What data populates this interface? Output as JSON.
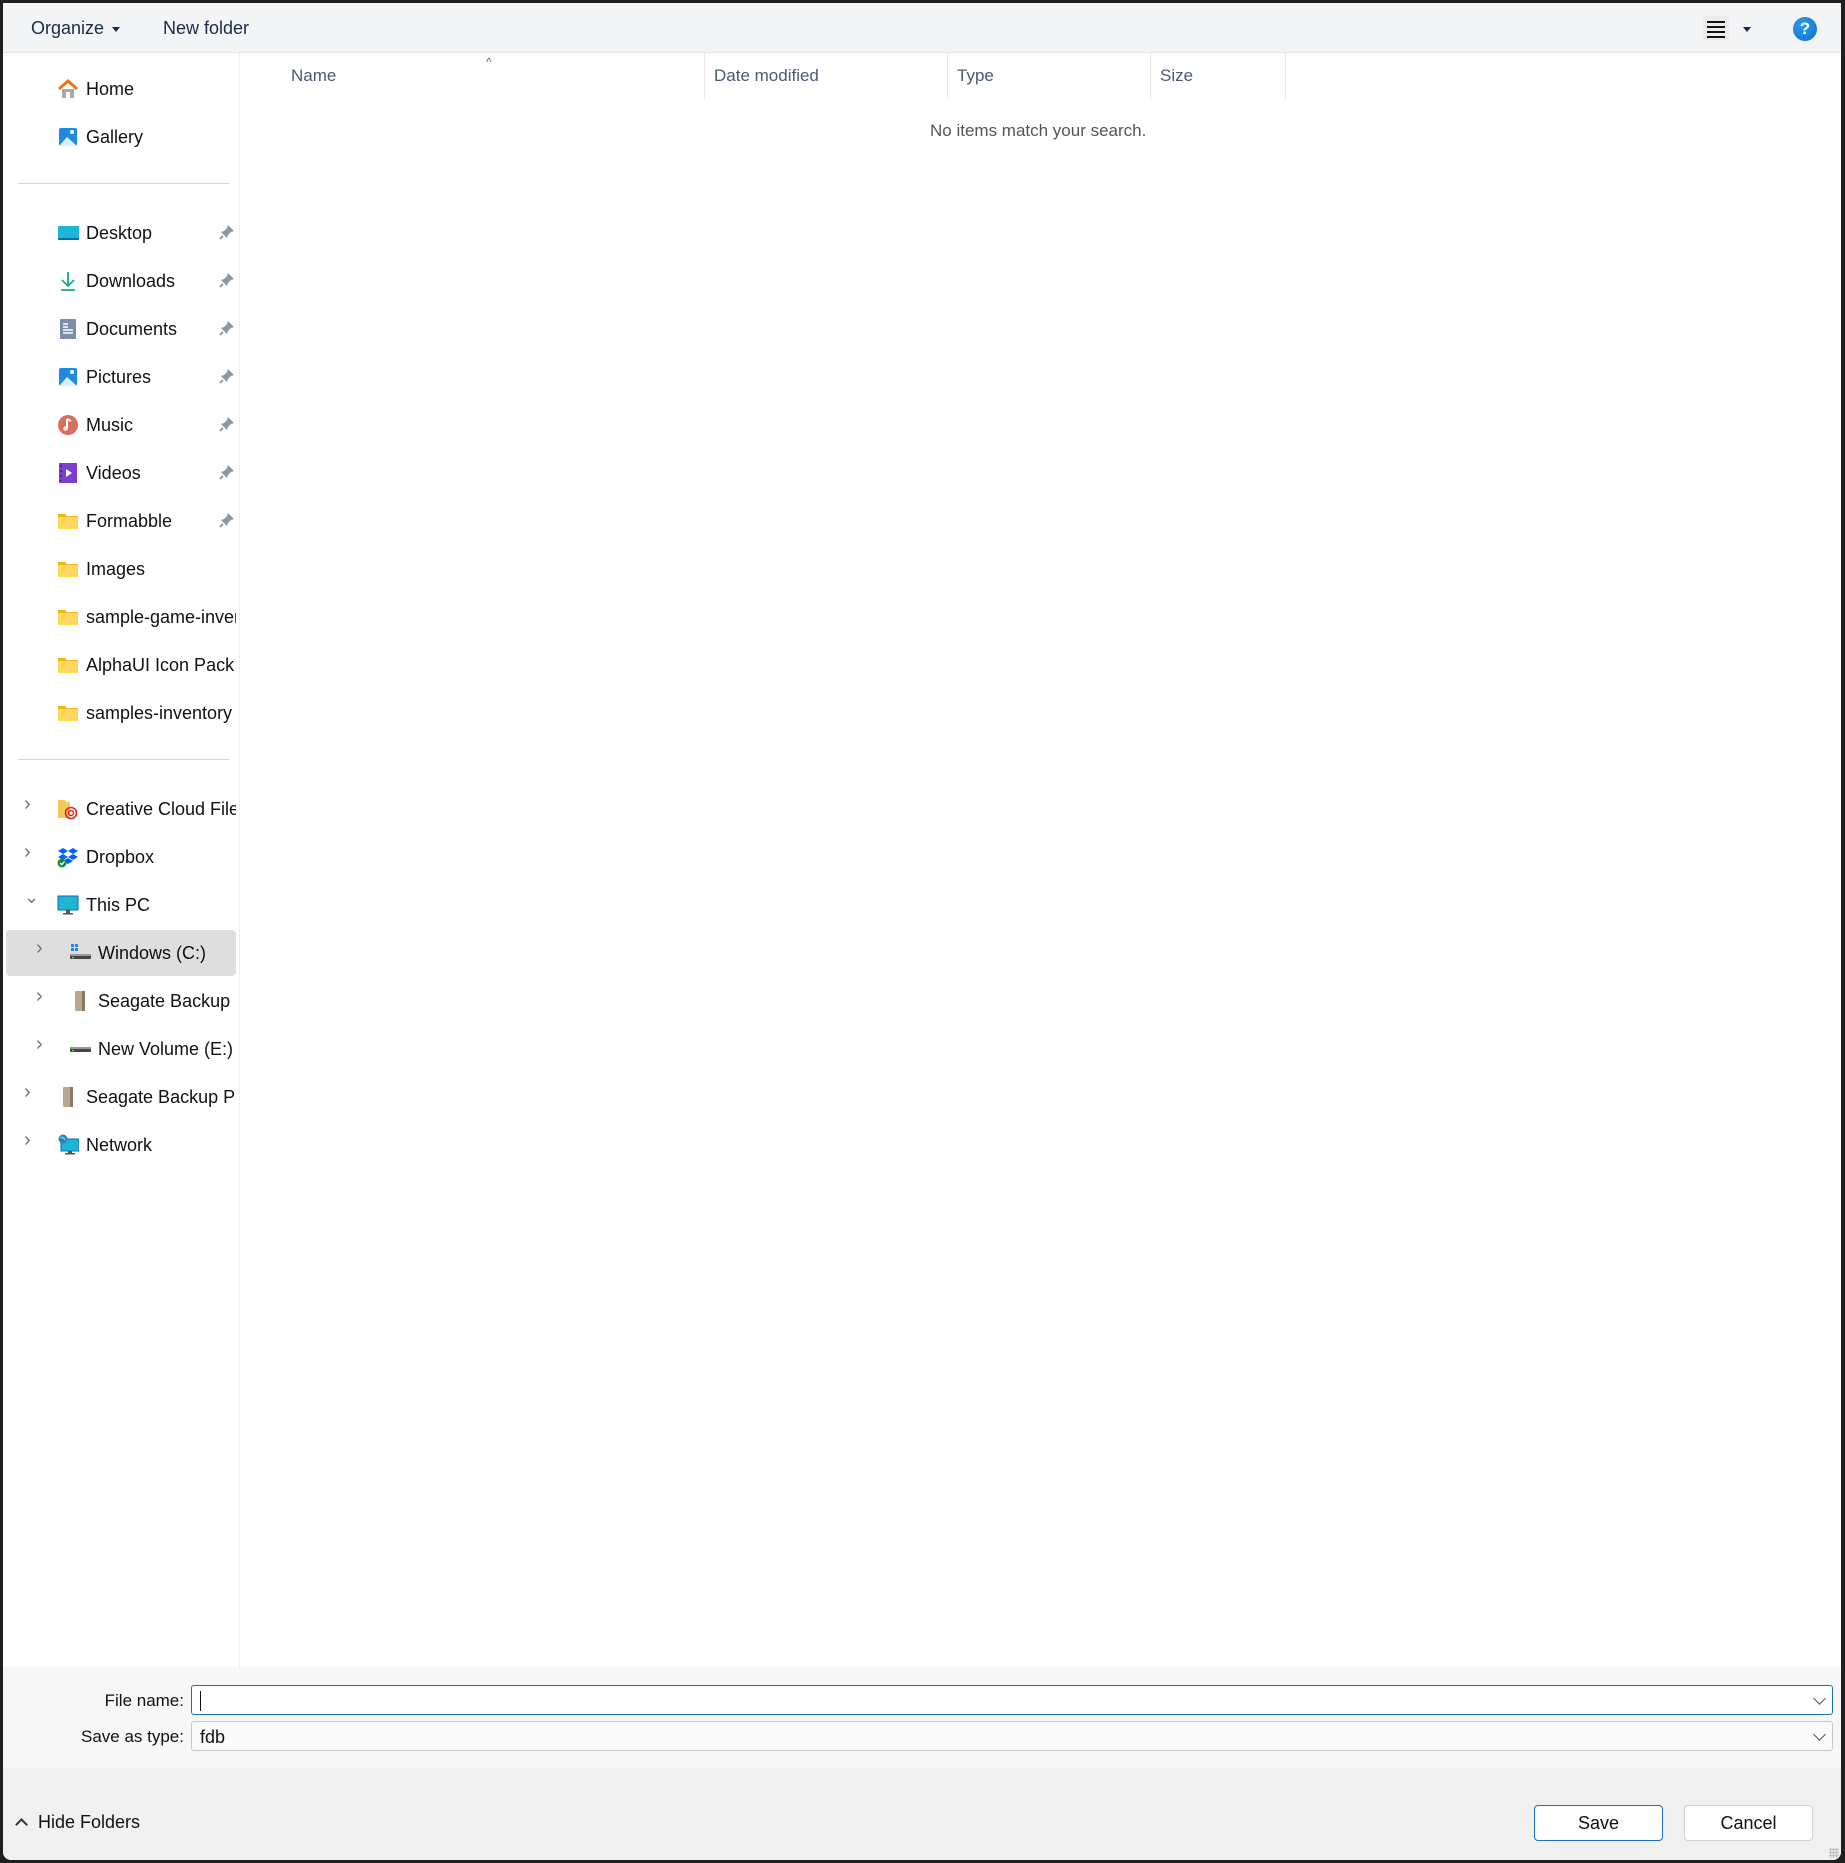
{
  "toolbar": {
    "organize_label": "Organize",
    "new_folder_label": "New folder",
    "view_icon": "list-view-icon",
    "help_icon": "help-icon",
    "help_glyph": "?"
  },
  "sidebar": {
    "quick": [
      {
        "label": "Home",
        "icon": "home-icon"
      },
      {
        "label": "Gallery",
        "icon": "gallery-icon"
      }
    ],
    "pinned": [
      {
        "label": "Desktop",
        "icon": "desktop-folder-icon",
        "pinned": true
      },
      {
        "label": "Downloads",
        "icon": "downloads-icon",
        "pinned": true
      },
      {
        "label": "Documents",
        "icon": "documents-icon",
        "pinned": true
      },
      {
        "label": "Pictures",
        "icon": "pictures-icon",
        "pinned": true
      },
      {
        "label": "Music",
        "icon": "music-icon",
        "pinned": true
      },
      {
        "label": "Videos",
        "icon": "videos-icon",
        "pinned": true
      },
      {
        "label": "Formabble",
        "icon": "folder-icon",
        "pinned": true
      },
      {
        "label": "Images",
        "icon": "folder-icon",
        "pinned": false
      },
      {
        "label": "sample-game-inver",
        "icon": "folder-icon",
        "pinned": false
      },
      {
        "label": "AlphaUI Icon Pack S",
        "icon": "folder-icon",
        "pinned": false
      },
      {
        "label": "samples-inventory",
        "icon": "folder-icon",
        "pinned": false
      }
    ],
    "tree": [
      {
        "label": "Creative Cloud Files",
        "icon": "creative-cloud-icon",
        "expanded": false,
        "level": 0
      },
      {
        "label": "Dropbox",
        "icon": "dropbox-icon",
        "expanded": false,
        "level": 0
      },
      {
        "label": "This PC",
        "icon": "this-pc-icon",
        "expanded": true,
        "level": 0
      },
      {
        "label": "Windows (C:)",
        "icon": "windows-drive-icon",
        "expanded": false,
        "level": 1,
        "selected": true
      },
      {
        "label": "Seagate Backup Pl",
        "icon": "external-drive-icon",
        "expanded": false,
        "level": 1
      },
      {
        "label": "New Volume (E:)",
        "icon": "drive-icon",
        "expanded": false,
        "level": 1
      },
      {
        "label": "Seagate Backup Plu",
        "icon": "external-drive-icon",
        "expanded": false,
        "level": 0
      },
      {
        "label": "Network",
        "icon": "network-icon",
        "expanded": false,
        "level": 0
      }
    ]
  },
  "main": {
    "columns": [
      "Name",
      "Date modified",
      "Type",
      "Size"
    ],
    "sort_column": "Name",
    "empty_message": "No items match your search."
  },
  "form": {
    "file_name_label": "File name:",
    "file_name_value": "",
    "save_type_label": "Save as type:",
    "save_type_value": "fdb"
  },
  "footer": {
    "hide_folders_label": "Hide Folders",
    "save_label": "Save",
    "cancel_label": "Cancel"
  },
  "colors": {
    "accent": "#1a6fc4",
    "selected_row": "#dedede",
    "toolbar_bg": "#f3f4f6"
  }
}
